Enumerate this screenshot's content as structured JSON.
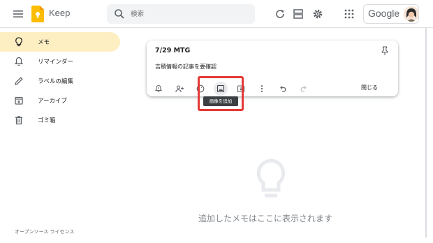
{
  "header": {
    "app_name": "Keep",
    "search_placeholder": "検索",
    "account_brand": "Google",
    "icons": [
      "menu-icon",
      "keep-logo-icon",
      "search-icon",
      "refresh-icon",
      "list-view-icon",
      "settings-icon",
      "apps-grid-icon"
    ]
  },
  "sidebar": {
    "items": [
      {
        "label": "メモ",
        "icon": "lightbulb-icon",
        "active": true
      },
      {
        "label": "リマインダー",
        "icon": "bell-icon",
        "active": false
      },
      {
        "label": "ラベルの編集",
        "icon": "pencil-icon",
        "active": false
      },
      {
        "label": "アーカイブ",
        "icon": "archive-icon",
        "active": false
      },
      {
        "label": "ゴミ箱",
        "icon": "trash-icon",
        "active": false
      }
    ],
    "footer_link": "オープンソース ライセンス"
  },
  "note": {
    "title": "7/29 MTG",
    "body": "吉積情報の記事を要確認",
    "close_label": "閉じる",
    "toolbar_icons": [
      "remind-me-icon",
      "collaborator-icon",
      "palette-icon",
      "add-image-icon",
      "archive-icon",
      "more-vert-icon",
      "undo-icon",
      "redo-icon"
    ],
    "tooltip": "画像を追加"
  },
  "empty_state": {
    "message": "追加したメモはここに表示されます",
    "icon": "lightbulb-icon"
  },
  "colors": {
    "active_bg": "#feefc3",
    "highlight": "#e53935",
    "keep_yellow": "#fbbc04"
  }
}
